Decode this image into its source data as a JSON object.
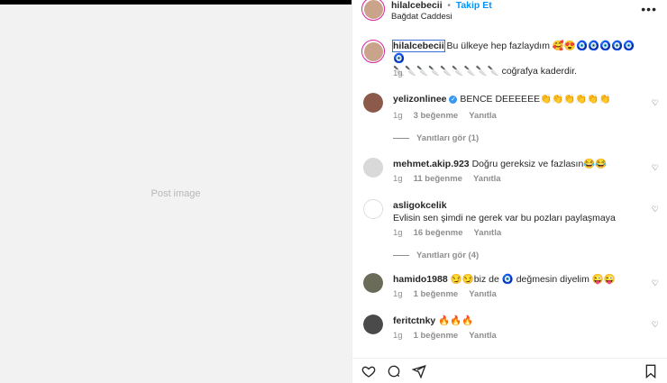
{
  "header": {
    "username": "hilalcebecii",
    "separator": "•",
    "follow_label": "Takip Et",
    "location": "Bağdat Caddesi",
    "more_icon": "more-horizontal-icon"
  },
  "media": {
    "placeholder": "Post image"
  },
  "caption": {
    "username": "hilalcebecii",
    "text_line1": "Bu ülkeye hep fazlaydım 🥰😍🧿🧿🧿🧿🧿🧿",
    "text_line2": "🔪🔪🔪🔪🔪🔪🔪🔪🔪 coğrafya kaderdir.",
    "time": "1g"
  },
  "comments": [
    {
      "username": "yelizonlinee",
      "verified": true,
      "text": "BENCE DEEEEEE👏👏👏👏👏👏",
      "time": "1g",
      "likes": "3 beğenme",
      "reply": "Yanıtla",
      "replies": "Yanıtları gör (1)"
    },
    {
      "username": "mehmet.akip.923",
      "text": "Doğru gereksiz ve fazlasın😂😂",
      "time": "1g",
      "likes": "11 beğenme",
      "reply": "Yanıtla"
    },
    {
      "username": "asligokcelik",
      "text": "Evlisin sen şimdi ne gerek var bu pozları paylaşmaya",
      "time": "1g",
      "likes": "16 beğenme",
      "reply": "Yanıtla",
      "replies": "Yanıtları gör (4)"
    },
    {
      "username": "hamido1988",
      "text": "😏😏biz de 🧿 değmesin diyelim 😜😜",
      "time": "1g",
      "likes": "1 beğenme",
      "reply": "Yanıtla"
    },
    {
      "username": "feritctnky",
      "text": "🔥🔥🔥",
      "time": "1g",
      "likes": "1 beğenme",
      "reply": "Yanıtla"
    }
  ],
  "actions": {
    "like_icon": "heart-icon",
    "comment_icon": "comment-icon",
    "share_icon": "share-icon",
    "save_icon": "bookmark-icon"
  }
}
